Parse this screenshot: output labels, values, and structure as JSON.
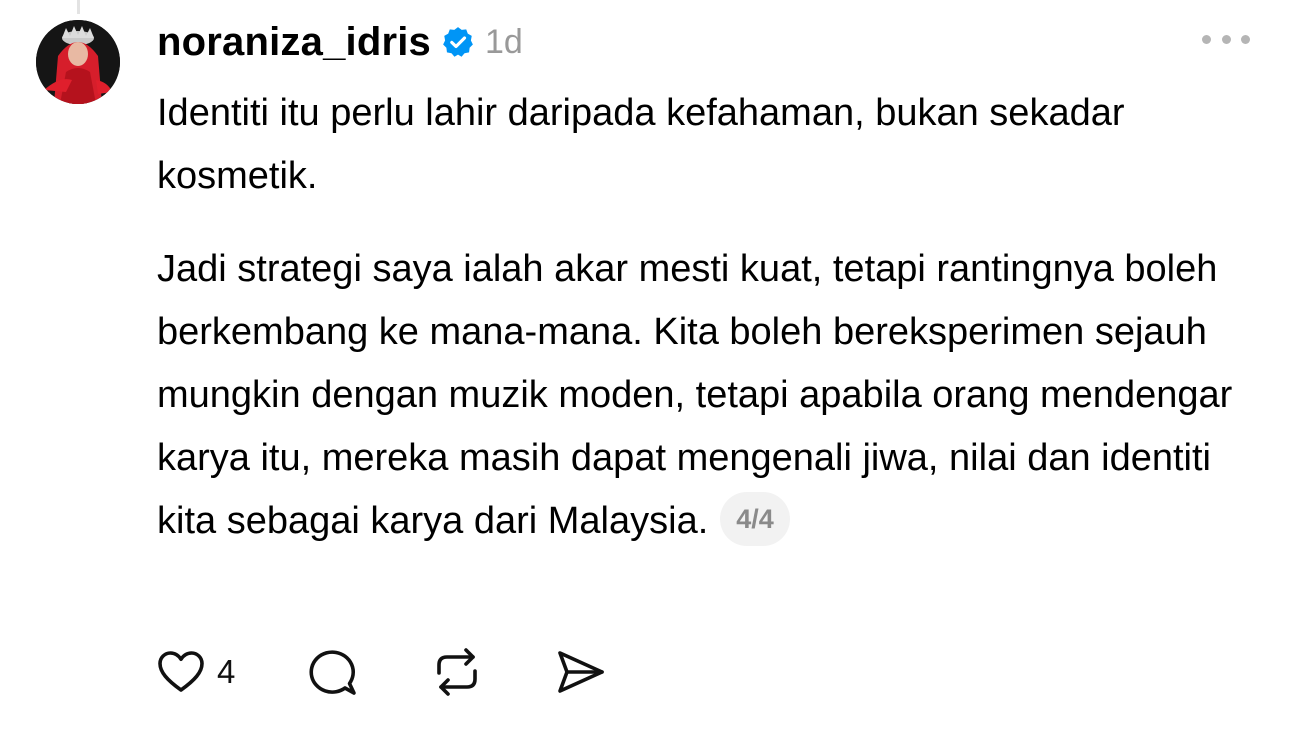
{
  "post": {
    "username": "noraniza_idris",
    "timestamp": "1d",
    "verified_icon": "verified-badge-icon",
    "more_icon": "more-icon",
    "paragraphs": [
      "Identiti itu perlu lahir daripada kefahaman, bukan sekadar kosmetik.",
      "Jadi strategi saya ialah akar mesti kuat, tetapi rantingnya boleh berkembang ke mana-mana. Kita boleh bereksperimen sejauh mungkin dengan muzik moden, tetapi apabila orang mendengar karya itu, mereka masih dapat mengenali jiwa, nilai dan identiti kita sebagai karya dari Malaysia."
    ],
    "page_indicator": "4/4"
  },
  "actions": {
    "like_count": "4",
    "like_icon": "heart-icon",
    "comment_icon": "comment-icon",
    "repost_icon": "repost-icon",
    "share_icon": "share-icon"
  },
  "colors": {
    "verified_blue": "#0095f6",
    "muted_text": "#999999",
    "avatar_red": "#d61e2b"
  }
}
